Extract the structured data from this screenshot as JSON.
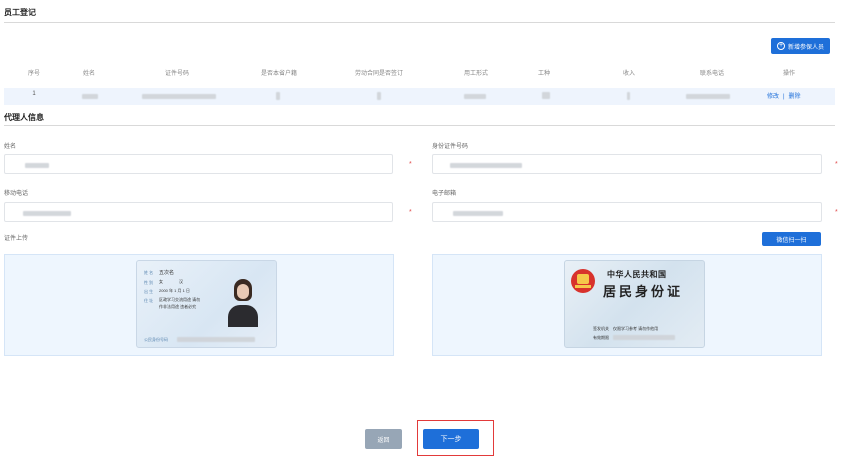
{
  "section1": {
    "title": "员工登记"
  },
  "add_button": {
    "label": "新增参保人员",
    "icon": "plus-circle-icon"
  },
  "table": {
    "columns": [
      "序号",
      "姓名",
      "证件号码",
      "是否本省户籍",
      "劳动合同是否签订",
      "用工形式",
      "工种",
      "收入",
      "联系电话",
      "操作"
    ],
    "rows": [
      {
        "index": "1",
        "edit": "修改",
        "sep": "|",
        "delete": "删除"
      }
    ]
  },
  "section2": {
    "title": "代理人信息"
  },
  "form": {
    "name_label": "姓名",
    "id_label": "身份证件号码",
    "phone_label": "移动电话",
    "email_label": "电子邮箱",
    "upload_label": "证件上传",
    "required_mark": "*"
  },
  "scan_button": {
    "label": "微信扫一扫"
  },
  "id_front": {
    "field_labels": [
      "姓 名",
      "性 别",
      "出 生",
      "住 址"
    ],
    "name_value": "五次名",
    "gender_value": "女",
    "ethnicity_value": "汉",
    "birth_value": "2000 年 1 月 1 日",
    "address_line1": "区政学习交流用途 请勿",
    "address_line2": "作非法用途 违者必究",
    "id_label": "公民身份号码"
  },
  "id_back": {
    "line1": "中华人民共和国",
    "line2": "居民身份证",
    "authority_label": "签发机关",
    "authority_value": "仅限学习参考 请勿作他用",
    "validity_label": "有效期限"
  },
  "footer": {
    "back_label": "返回",
    "next_label": "下一步"
  },
  "colors": {
    "primary": "#1e6fd9",
    "highlight": "#e23a3a"
  }
}
